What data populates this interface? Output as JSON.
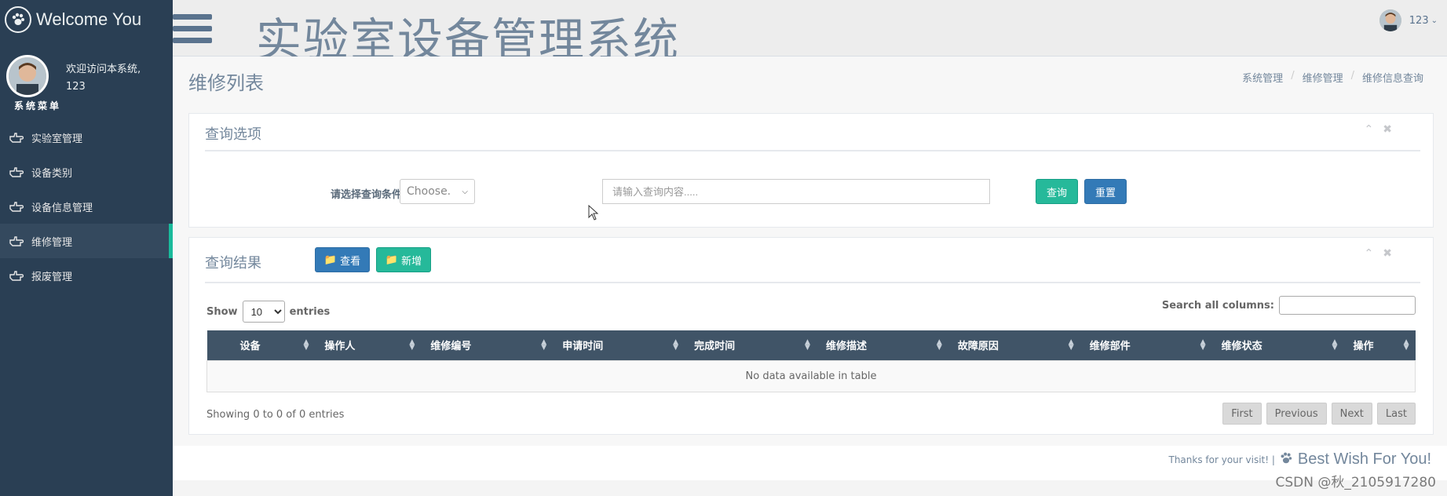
{
  "sidebar": {
    "brand": "Welcome You",
    "welcome": "欢迎访问本系统,",
    "username": "123",
    "menu_title": "系统菜单",
    "items": [
      {
        "label": "实验室管理"
      },
      {
        "label": "设备类别"
      },
      {
        "label": "设备信息管理"
      },
      {
        "label": "维修管理"
      },
      {
        "label": "报废管理"
      }
    ]
  },
  "topnav": {
    "system_title": "实验室设备管理系统",
    "user": "123"
  },
  "page": {
    "title": "维修列表",
    "breadcrumb": [
      "系统管理",
      "维修管理",
      "维修信息查询"
    ]
  },
  "query_panel": {
    "title": "查询选项",
    "condition_label": "请选择查询条件",
    "select_value": "Choose.",
    "input_placeholder": "请输入查询内容.....",
    "search_button": "查询",
    "reset_button": "重置"
  },
  "results_panel": {
    "title": "查询结果",
    "view_button": "查看",
    "add_button": "新增",
    "show_label": "Show",
    "page_length": "10",
    "entries_label": "entries",
    "search_label": "Search all columns:",
    "columns": [
      "设备",
      "操作人",
      "维修编号",
      "申请时间",
      "完成时间",
      "维修描述",
      "故障原因",
      "维修部件",
      "维修状态",
      "操作"
    ],
    "empty_text": "No data available in table",
    "info": "Showing 0 to 0 of 0 entries",
    "pager": [
      "First",
      "Previous",
      "Next",
      "Last"
    ]
  },
  "footer": {
    "thanks": "Thanks for your visit! |",
    "brand": "Best Wish For You!"
  },
  "watermark": "CSDN @秋_2105917280",
  "colors": {
    "sidebar": "#2a3f54",
    "accent_green": "#26b99a",
    "accent_blue": "#337ab7",
    "table_header": "#405467"
  }
}
